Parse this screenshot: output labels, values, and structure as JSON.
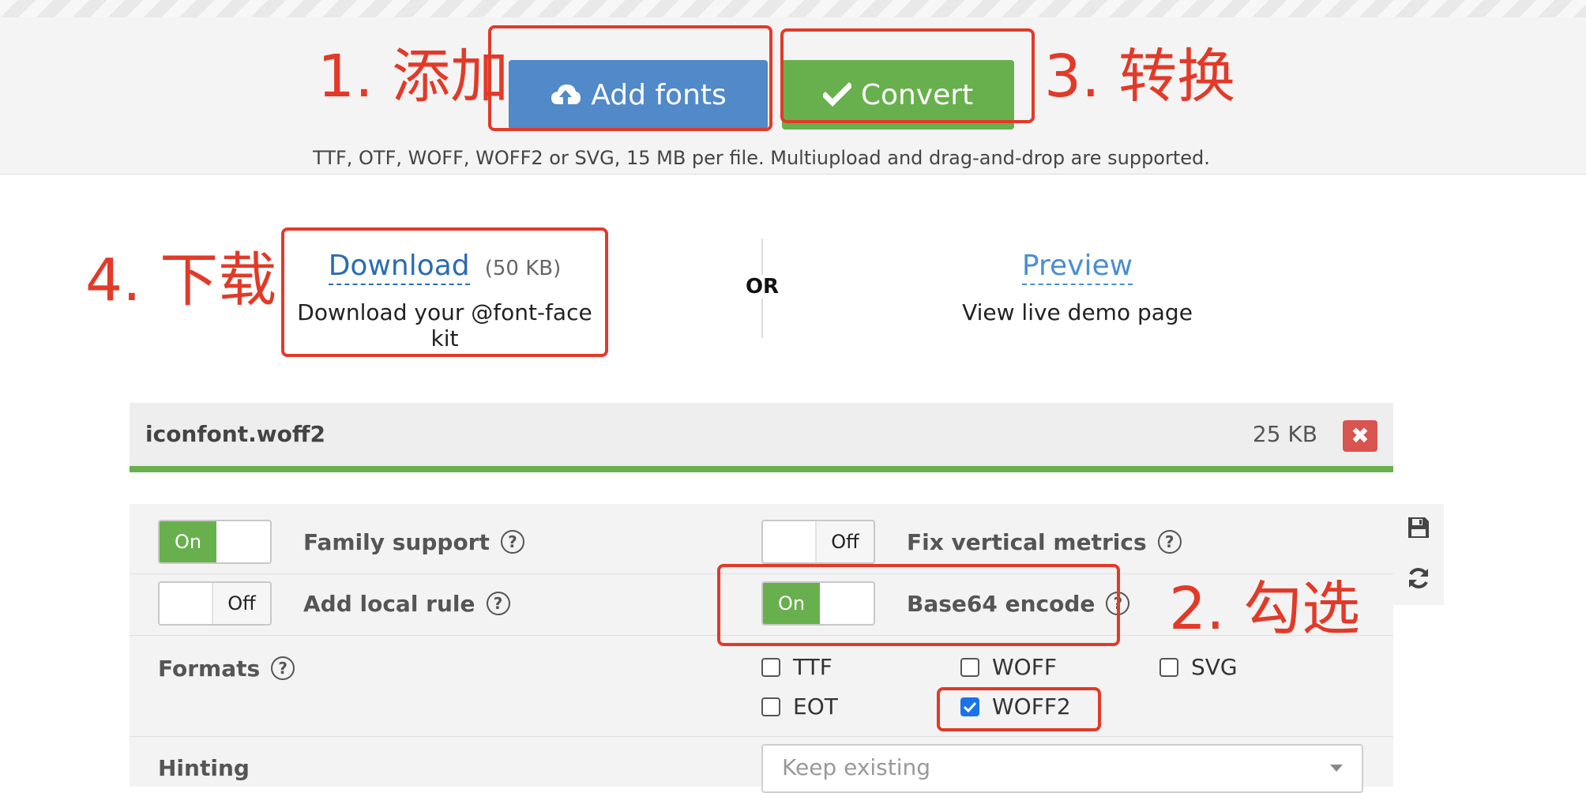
{
  "toolbar": {
    "add_fonts_label": "Add fonts",
    "convert_label": "Convert",
    "formats_note": "TTF, OTF, WOFF, WOFF2 or SVG, 15 MB per file. Multiupload and drag-and-drop are supported."
  },
  "annotations": {
    "step1": "1. 添加",
    "step2": "2. 勾选",
    "step3": "3. 转换",
    "step4": "4. 下载"
  },
  "download": {
    "link_label": "Download",
    "size": "(50 KB)",
    "description": "Download your @font-face kit"
  },
  "divider": {
    "or_label": "OR"
  },
  "preview": {
    "link_label": "Preview",
    "description": "View live demo page"
  },
  "file": {
    "name": "iconfont.woff2",
    "size": "25 KB",
    "remove_label": "✖"
  },
  "options": {
    "family_support": {
      "label": "Family support",
      "state": "On"
    },
    "fix_vertical_metrics": {
      "label": "Fix vertical metrics",
      "state": "Off"
    },
    "add_local_rule": {
      "label": "Add local rule",
      "state": "Off"
    },
    "base64_encode": {
      "label": "Base64 encode",
      "state": "On"
    },
    "help_glyph": "?"
  },
  "formats": {
    "label": "Formats",
    "items": [
      {
        "label": "TTF",
        "checked": false
      },
      {
        "label": "WOFF",
        "checked": false
      },
      {
        "label": "SVG",
        "checked": false
      },
      {
        "label": "EOT",
        "checked": false
      },
      {
        "label": "WOFF2",
        "checked": true
      }
    ]
  },
  "hinting": {
    "label": "Hinting",
    "selected": "Keep existing"
  },
  "colors": {
    "primary_blue": "#5189c9",
    "success_green": "#68b04d",
    "annotation_red": "#e23a29",
    "danger_red": "#d9534f"
  },
  "icons": {
    "add": "cloud-upload-icon",
    "convert": "checkmark-icon",
    "save": "floppy-disk-icon",
    "reset": "refresh-icon"
  }
}
